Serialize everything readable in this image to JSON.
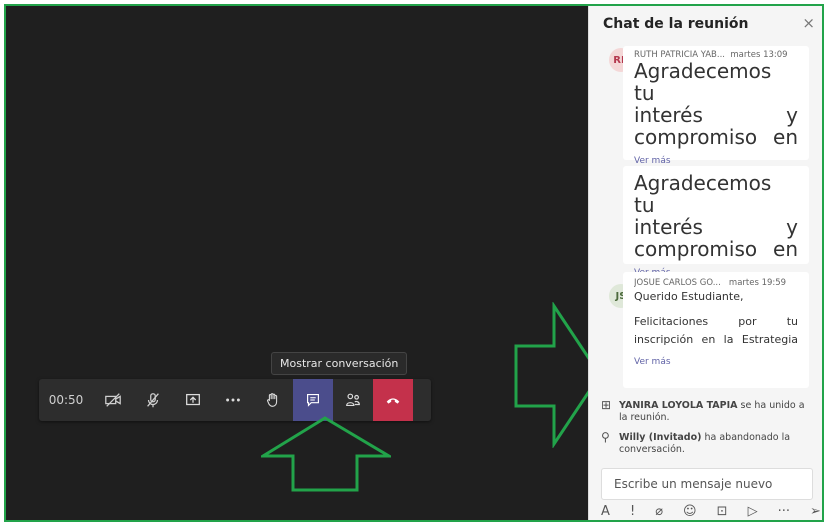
{
  "call": {
    "timer": "00:50",
    "tooltip": "Mostrar conversación"
  },
  "chat": {
    "title": "Chat de la reunión",
    "close_glyph": "×",
    "messages": [
      {
        "initials": "RR",
        "sender": "RUTH PATRICIA YAB...",
        "time": "martes 13:09",
        "lines": [
          "Agradecemos tu",
          "interés y",
          "compromiso en"
        ],
        "more": "Ver más"
      },
      {
        "lines": [
          "Agradecemos tu",
          "interés y",
          "compromiso en"
        ],
        "more": "Ver más"
      },
      {
        "initials": "JS",
        "sender": "JOSUE CARLOS GO...",
        "time": "martes 19:59",
        "greeting": "Querido Estudiante,",
        "body1": "Felicitaciones por tu",
        "body2": "inscripción en la Estrategia",
        "more": "Ver más"
      }
    ],
    "system": [
      {
        "name": "YANIRA LOYOLA TAPIA",
        "text": " se ha unido a la reunión."
      },
      {
        "name": "Willy (Invitado)",
        "text": " ha abandonado la conversación."
      }
    ],
    "placeholder": "Escribe un mensaje nuevo",
    "compose_icons": [
      "A",
      "!",
      "⌀",
      "☺",
      "⊡",
      "▷",
      "···",
      "➢"
    ]
  },
  "colors": {
    "accent": "#6264a7",
    "hangup": "#c4314b",
    "annotation": "#22a34a"
  }
}
